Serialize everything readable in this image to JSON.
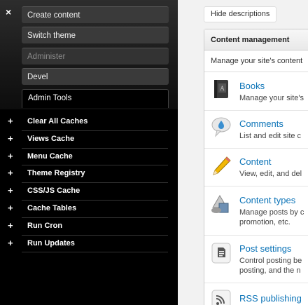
{
  "overlay": {
    "close_label": "×",
    "tabs": [
      {
        "label": "Create content",
        "state": "normal"
      },
      {
        "label": "Switch theme",
        "state": "normal"
      },
      {
        "label": "Administer",
        "state": "dim"
      },
      {
        "label": "Devel",
        "state": "normal"
      },
      {
        "label": "Admin Tools",
        "state": "active"
      }
    ],
    "expand_glyph": "+",
    "items": [
      {
        "label": "Clear All Caches"
      },
      {
        "label": "Views Cache"
      },
      {
        "label": "Menu Cache"
      },
      {
        "label": "Theme Registry"
      },
      {
        "label": "CSS/JS Cache"
      },
      {
        "label": "Cache Tables"
      },
      {
        "label": "Run Cron"
      },
      {
        "label": "Run Updates"
      }
    ]
  },
  "content": {
    "hide_descriptions_label": "Hide descriptions",
    "panel_title": "Content management",
    "panel_description": "Manage your site's content",
    "entries": [
      {
        "title": "Books",
        "desc1": "Manage your site's",
        "desc2": "",
        "icon": "book-icon"
      },
      {
        "title": "Comments",
        "desc1": "List and edit site c",
        "desc2": "",
        "icon": "comment-bubble-icon"
      },
      {
        "title": "Content",
        "desc1": "View, edit, and del",
        "desc2": "",
        "icon": "pencil-icon"
      },
      {
        "title": "Content types",
        "desc1": "Manage posts by c",
        "desc2": "promotion, etc.",
        "icon": "shapes-icon"
      },
      {
        "title": "Post settings",
        "desc1": "Control posting be",
        "desc2": "posting, and the n",
        "icon": "document-icon"
      },
      {
        "title": "RSS publishing",
        "desc1": "",
        "desc2": "",
        "icon": "rss-icon"
      }
    ]
  }
}
